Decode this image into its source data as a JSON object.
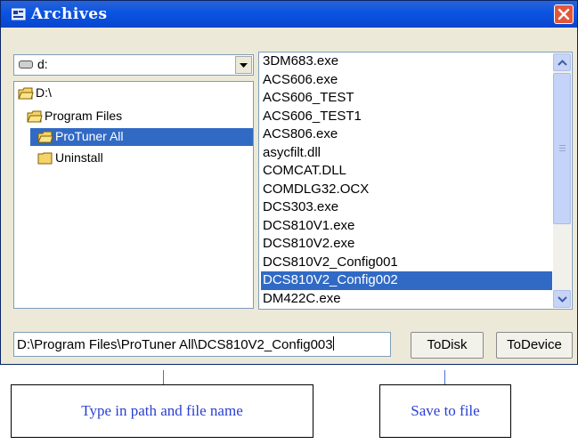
{
  "window": {
    "title": "Archives"
  },
  "drive_selector": {
    "value": "d:"
  },
  "directories": [
    {
      "label": "D:\\",
      "selected": false
    },
    {
      "label": "Program Files",
      "selected": false
    },
    {
      "label": "ProTuner All",
      "selected": true
    },
    {
      "label": "Uninstall",
      "selected": false
    }
  ],
  "files": [
    {
      "label": "3DM683.exe",
      "selected": false
    },
    {
      "label": "ACS606.exe",
      "selected": false
    },
    {
      "label": "ACS606_TEST",
      "selected": false
    },
    {
      "label": "ACS606_TEST1",
      "selected": false
    },
    {
      "label": "ACS806.exe",
      "selected": false
    },
    {
      "label": "asycfilt.dll",
      "selected": false
    },
    {
      "label": "COMCAT.DLL",
      "selected": false
    },
    {
      "label": "COMDLG32.OCX",
      "selected": false
    },
    {
      "label": "DCS303.exe",
      "selected": false
    },
    {
      "label": "DCS810V1.exe",
      "selected": false
    },
    {
      "label": "DCS810V2.exe",
      "selected": false
    },
    {
      "label": "DCS810V2_Config001",
      "selected": false
    },
    {
      "label": "DCS810V2_Config002",
      "selected": true
    },
    {
      "label": "DM422C.exe",
      "selected": false
    }
  ],
  "path_input": {
    "value": "D:\\Program Files\\ProTuner All\\DCS810V2_Config003"
  },
  "buttons": {
    "todisk": "ToDisk",
    "todevice": "ToDevice"
  },
  "annotations": {
    "path_callout": "Type in path and file name",
    "save_callout": "Save to file"
  }
}
